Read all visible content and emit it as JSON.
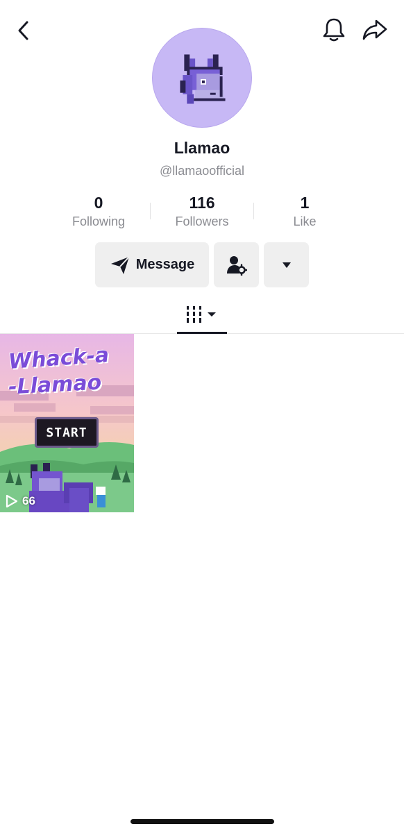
{
  "profile": {
    "name": "Llamao",
    "handle": "@llamaoofficial"
  },
  "stats": {
    "following": {
      "value": "0",
      "label": "Following"
    },
    "followers": {
      "value": "116",
      "label": "Followers"
    },
    "likes": {
      "value": "1",
      "label": "Like"
    }
  },
  "actions": {
    "message_label": "Message"
  },
  "videos": [
    {
      "thumbnail_title_line1": "Whack-a",
      "thumbnail_title_line2": "-Llamao",
      "thumbnail_button": "START",
      "views": "66"
    }
  ],
  "icons": {
    "back": "chevron-left-icon",
    "notifications": "bell-icon",
    "share": "share-arrow-icon",
    "message": "send-icon",
    "add_friend": "person-settings-icon",
    "more": "caret-down-icon",
    "videos_tab": "grid-bars-icon",
    "play": "play-outline-icon"
  },
  "colors": {
    "avatar_bg": "#c7b8f5",
    "button_bg": "#efefef",
    "secondary_text": "#8a8b91",
    "primary_text": "#161823"
  }
}
